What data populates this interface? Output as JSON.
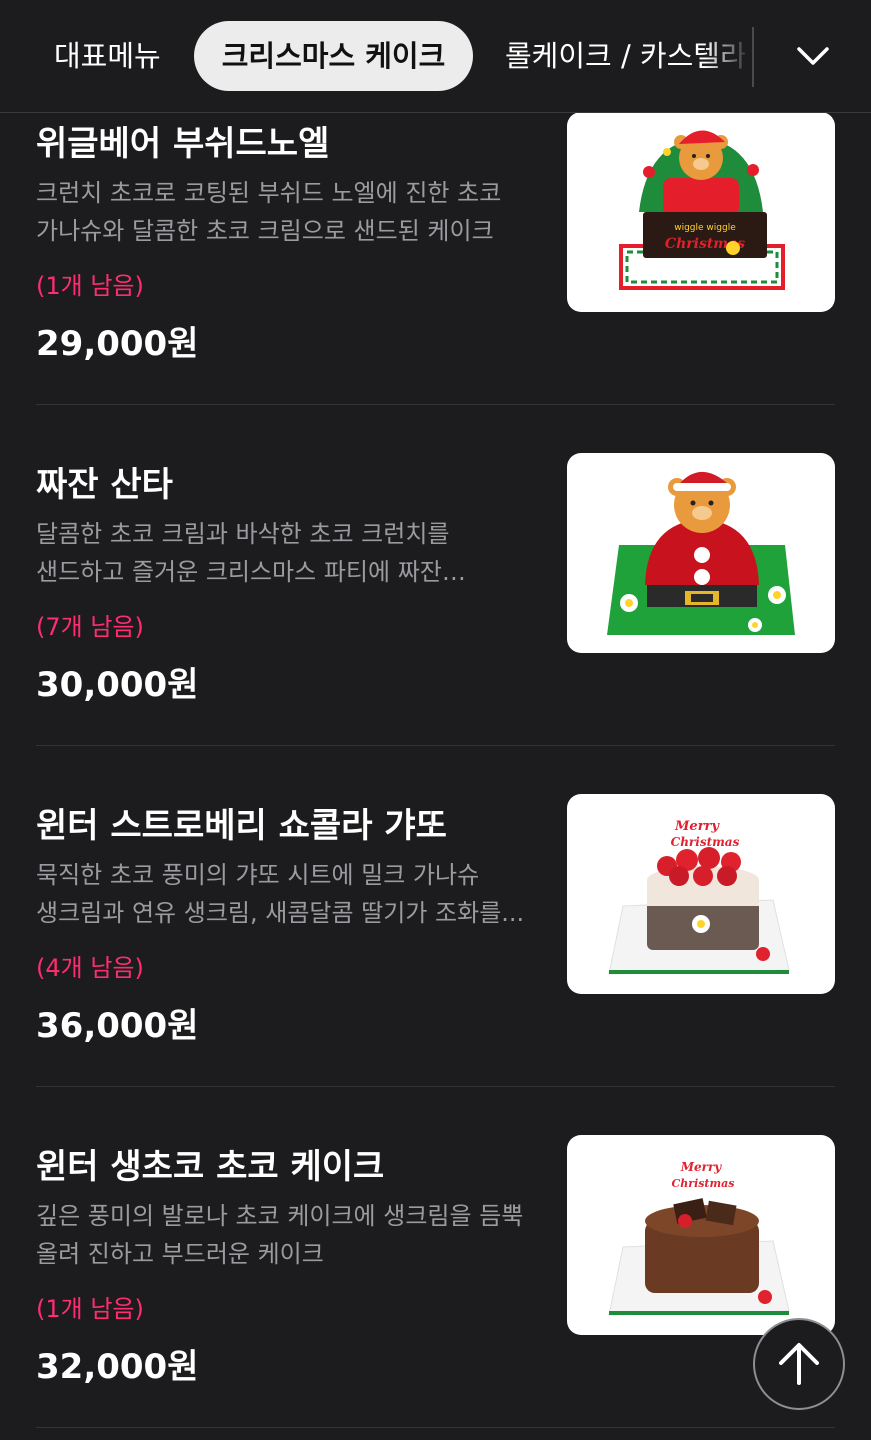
{
  "tabs": {
    "items": [
      {
        "label": "대표메뉴"
      },
      {
        "label": "크리스마스 케이크"
      },
      {
        "label": "롤케이크 / 카스텔라"
      }
    ],
    "active_index": 1,
    "expand_icon": "chevron-down-icon"
  },
  "products": [
    {
      "name": "위글베어 부쉬드노엘",
      "description": "크런치 초코로 코팅된 부쉬드 노엘에 진한 초코 가나슈와 달콤한 초코 크림으로 샌드된 케이크",
      "stock": "(1개 남음)",
      "price": "29,000원"
    },
    {
      "name": "짜잔 산타",
      "description": "달콤한 초코 크림과 바삭한 초코 크런치를 샌드하고 즐거운 크리스마스 파티에 짜잔 등장한...",
      "stock": "(7개 남음)",
      "price": "30,000원"
    },
    {
      "name": "윈터 스트로베리 쇼콜라 갸또",
      "description": "묵직한 초코 풍미의 갸또 시트에 밀크 가나슈 생크림과 연유 생크림, 새콤달콤 딸기가 조화를...",
      "stock": "(4개 남음)",
      "price": "36,000원"
    },
    {
      "name": "윈터 생초코 초코 케이크",
      "description": "깊은 풍미의 발로나 초코 케이크에 생크림을 듬뿍 올려 진하고 부드러운 케이크",
      "stock": "(1개 남음)",
      "price": "32,000원"
    }
  ],
  "scroll_top_icon": "arrow-up-icon",
  "colors": {
    "background": "#1c1c1e",
    "stock_accent": "#ff2d6f",
    "description": "#9b9b9f",
    "active_tab_bg": "#ececec"
  }
}
